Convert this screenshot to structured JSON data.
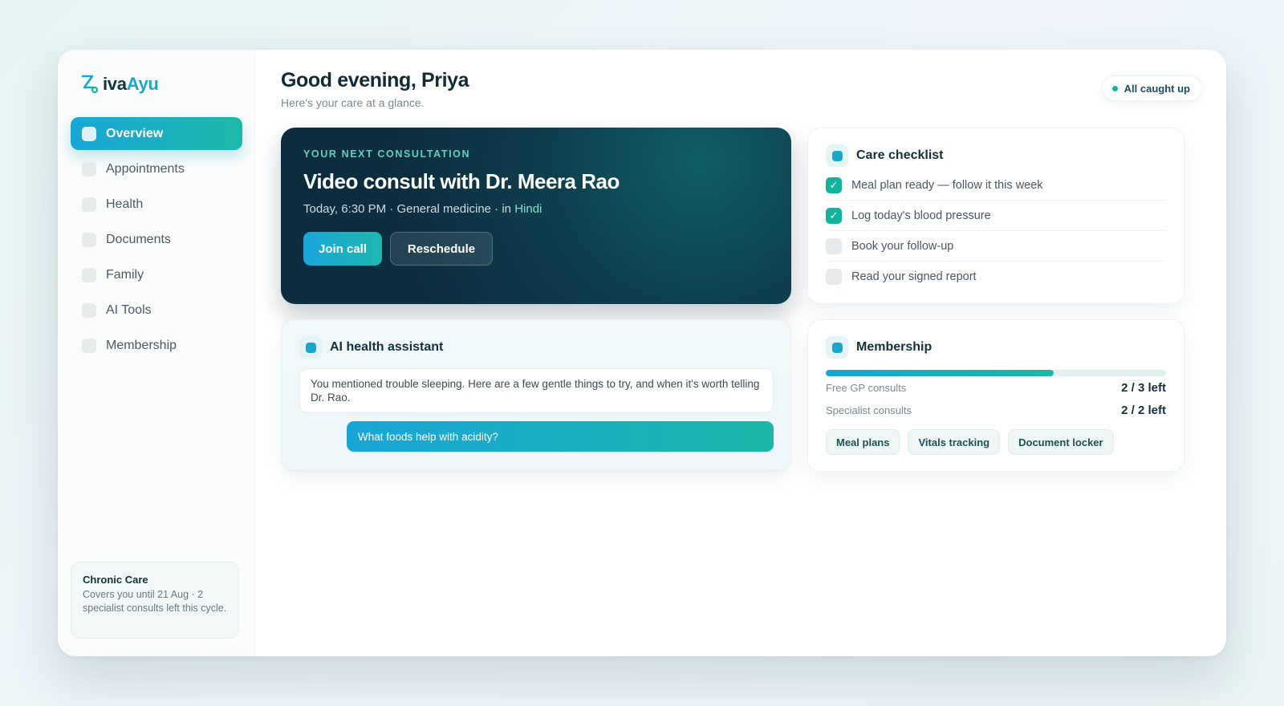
{
  "brand": {
    "name_prefix": "iva",
    "name_accent": "Ayu"
  },
  "sidebar": {
    "items": [
      {
        "label": "Overview",
        "active": true
      },
      {
        "label": "Appointments"
      },
      {
        "label": "Health"
      },
      {
        "label": "Documents"
      },
      {
        "label": "Family"
      },
      {
        "label": "AI Tools"
      },
      {
        "label": "Membership"
      }
    ],
    "plan": {
      "title": "Chronic Care",
      "description": "Covers you until 21 Aug · 2 specialist consults left this cycle."
    }
  },
  "header": {
    "greeting": "Good evening, Priya",
    "subtitle": "Here's your care at a glance.",
    "status": "All caught up"
  },
  "consultation": {
    "eyebrow": "YOUR NEXT CONSULTATION",
    "title": "Video consult with Dr. Meera Rao",
    "meta": "Today, 6:30 PM · General medicine · in ",
    "language": "Hindi",
    "join_label": "Join call",
    "reschedule_label": "Reschedule"
  },
  "checklist": {
    "title": "Care checklist",
    "items": [
      {
        "label": "Meal plan ready — follow it this week",
        "done": true
      },
      {
        "label": "Log today's blood pressure",
        "done": true
      },
      {
        "label": "Book your follow-up",
        "done": false
      },
      {
        "label": "Read your signed report",
        "done": false
      }
    ]
  },
  "assistant": {
    "title": "AI health assistant",
    "ai_message": "You mentioned trouble sleeping. Here are a few gentle things to try, and when it's worth telling Dr. Rao.",
    "user_message": "What foods help with acidity?"
  },
  "membership": {
    "title": "Membership",
    "progress": 0.67,
    "stats": [
      {
        "label": "Free GP consults",
        "value": "2 / 3 left"
      },
      {
        "label": "Specialist consults",
        "value": "2 / 2 left"
      }
    ],
    "perks": [
      "Meal plans",
      "Vitals tracking",
      "Document locker"
    ]
  },
  "colors": {
    "brand_teal": "#14b39b",
    "brand_blue": "#19a7d6",
    "consult_bg": "#0c2d3e"
  }
}
